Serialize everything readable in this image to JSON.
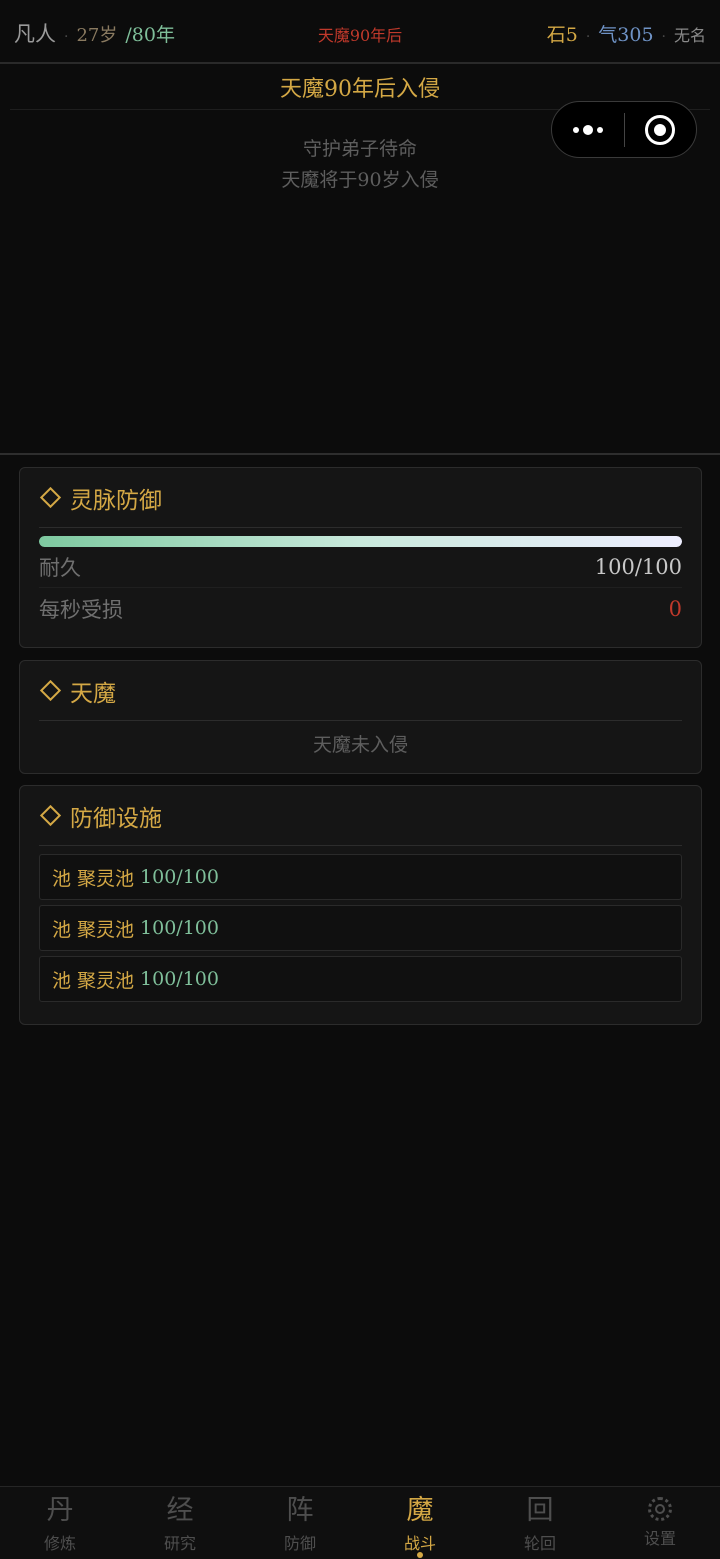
{
  "topbar": {
    "realm": "凡人",
    "sep": "·",
    "age": "27岁",
    "lifespan": "/80年",
    "warning": "天魔90年后",
    "stone": "石5",
    "qi": "气305",
    "name": "无名"
  },
  "event": {
    "title": "天魔90年后入侵",
    "lines": [
      "守护弟子待命",
      "天魔将于90岁入侵"
    ]
  },
  "defense_card": {
    "title": "灵脉防御",
    "durability_fraction": 1.0,
    "stats": [
      {
        "label": "耐久",
        "value": "100/100"
      },
      {
        "label": "每秒受损",
        "value": "0"
      }
    ]
  },
  "demon_card": {
    "title": "天魔",
    "empty": "天魔未入侵"
  },
  "facilities_card": {
    "title": "防御设施",
    "items": [
      {
        "name": "池 聚灵池",
        "value": "100/100"
      },
      {
        "name": "池 聚灵池",
        "value": "100/100"
      },
      {
        "name": "池 聚灵池",
        "value": "100/100"
      }
    ]
  },
  "nav": [
    {
      "glyph": "丹",
      "label": "修炼",
      "icon": "dan-icon"
    },
    {
      "glyph": "经",
      "label": "研究",
      "icon": "jing-icon"
    },
    {
      "glyph": "阵",
      "label": "防御",
      "icon": "zhen-icon"
    },
    {
      "glyph": "魔",
      "label": "战斗",
      "icon": "mo-icon",
      "active": true
    },
    {
      "glyph": "回",
      "label": "轮回",
      "icon": "hui-icon"
    },
    {
      "glyph": "",
      "label": "设置",
      "icon": "gear-icon"
    }
  ],
  "colors": {
    "accent": "#d4a845",
    "danger": "#c0392b",
    "jade": "#7fbf9a",
    "qi": "#6f93c6",
    "background": "#0c0c0c"
  }
}
